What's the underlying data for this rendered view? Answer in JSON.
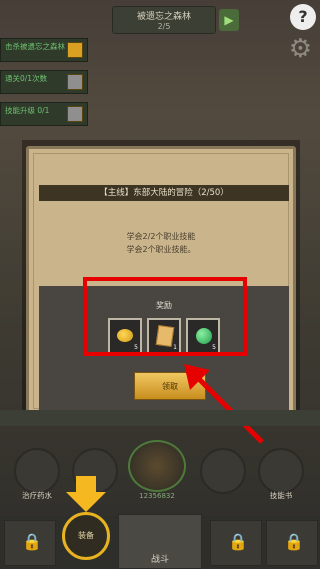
{
  "header": {
    "location": "被遗忘之森林",
    "progress": "2/5"
  },
  "sidebar_quests": [
    {
      "text": "击杀被遗忘之森林 1次",
      "icon": "gold-badge-icon"
    },
    {
      "text": "通关0/1次数",
      "icon": "grey-badge-icon"
    },
    {
      "text": "技能升级 0/1",
      "icon": "grey-badge-icon"
    }
  ],
  "quest_modal": {
    "title": "【主线】东部大陆的冒险（2/50）",
    "description_1": "学会2/2个职业技能",
    "description_2": "学会2个职业技能。",
    "rewards_title": "奖励",
    "rewards": [
      {
        "icon": "gold-coin-icon",
        "count": "5"
      },
      {
        "icon": "scroll-icon",
        "count": "1"
      },
      {
        "icon": "green-gem-icon",
        "count": "5"
      }
    ],
    "claim_button": "领取"
  },
  "bottom": {
    "items": [
      {
        "label": "治疗药水",
        "icon": "potion-icon"
      },
      {
        "label": "",
        "icon": "locked-slot-icon"
      },
      {
        "label": "12356832",
        "icon": "treasure-chest-icon"
      },
      {
        "label": "",
        "icon": "locked-slot-icon"
      },
      {
        "label": "技能书",
        "icon": "skill-book-icon"
      }
    ],
    "nav": {
      "equip": "装备",
      "battle": "战斗"
    }
  },
  "colors": {
    "highlight": "#e60000",
    "accent": "#e7b320"
  }
}
